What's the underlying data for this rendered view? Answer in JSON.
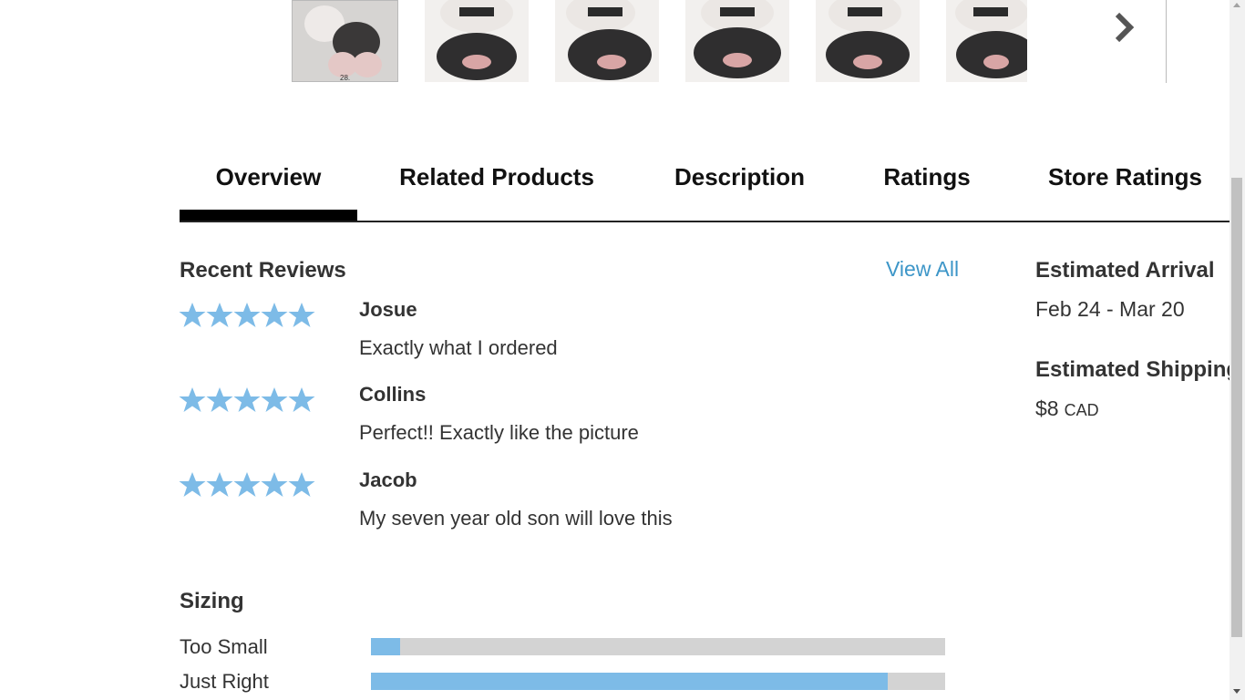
{
  "thumbnails": [
    {
      "name": "product-thumbnail-1",
      "caption": "28.",
      "selected": true
    },
    {
      "name": "product-thumbnail-2"
    },
    {
      "name": "product-thumbnail-3"
    },
    {
      "name": "product-thumbnail-4"
    },
    {
      "name": "product-thumbnail-5"
    },
    {
      "name": "product-thumbnail-6"
    }
  ],
  "next_icon": "chevron-right-icon",
  "tabs": [
    {
      "label": "Overview",
      "active": true
    },
    {
      "label": "Related Products"
    },
    {
      "label": "Description"
    },
    {
      "label": "Ratings"
    },
    {
      "label": "Store Ratings"
    }
  ],
  "reviews": {
    "title": "Recent Reviews",
    "view_all": "View All",
    "star_color": "#7dbbe7",
    "items": [
      {
        "name": "Josue",
        "text": "Exactly what I ordered",
        "stars": 5
      },
      {
        "name": "Collins",
        "text": "Perfect!! Exactly like the picture",
        "stars": 5
      },
      {
        "name": "Jacob",
        "text": "My seven year old son will love this",
        "stars": 5
      }
    ]
  },
  "arrival": {
    "title": "Estimated Arrival",
    "value": "Feb 24 - Mar 20"
  },
  "shipping": {
    "title": "Estimated Shipping",
    "amount": "$8",
    "currency": "CAD"
  },
  "sizing": {
    "title": "Sizing",
    "bar_color": "#7dbbe7",
    "rows": [
      {
        "label": "Too Small",
        "fraction": 0.05
      },
      {
        "label": "Just Right",
        "fraction": 0.9
      }
    ]
  }
}
